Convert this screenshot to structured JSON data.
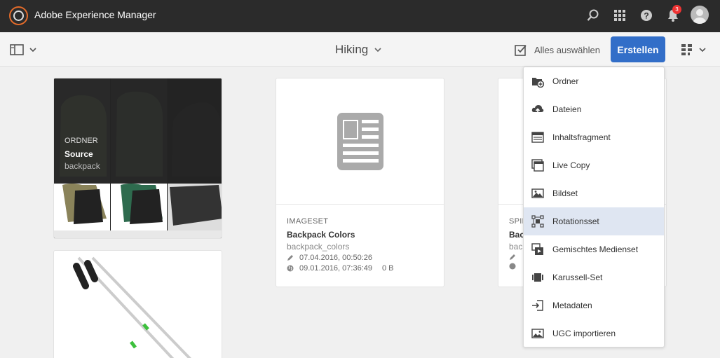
{
  "header": {
    "app_title": "Adobe Experience Manager",
    "notification_count": "3"
  },
  "actionbar": {
    "breadcrumb": "Hiking",
    "select_all_label": "Alles auswählen",
    "create_label": "Erstellen"
  },
  "cards": [
    {
      "type": "ORDNER",
      "title": "Source",
      "name": "backpack"
    },
    {
      "type": "IMAGESET",
      "title": "Backpack Colors",
      "name": "backpack_colors",
      "modified": "07.04.2016, 00:50:26",
      "published": "09.01.2016, 07:36:49",
      "size": "0 B"
    },
    {
      "type": "SPIN",
      "title": "Bac",
      "name": "back"
    }
  ],
  "create_menu": {
    "items": [
      {
        "label": "Ordner",
        "icon": "folder-add-icon"
      },
      {
        "label": "Dateien",
        "icon": "upload-cloud-icon"
      },
      {
        "label": "Inhaltsfragment",
        "icon": "content-fragment-icon"
      },
      {
        "label": "Live Copy",
        "icon": "live-copy-icon"
      },
      {
        "label": "Bildset",
        "icon": "image-set-icon"
      },
      {
        "label": "Rotationsset",
        "icon": "spin-set-icon"
      },
      {
        "label": "Gemischtes Medienset",
        "icon": "mixed-media-set-icon"
      },
      {
        "label": "Karussell-Set",
        "icon": "carousel-set-icon"
      },
      {
        "label": "Metadaten",
        "icon": "metadata-import-icon"
      },
      {
        "label": "UGC importieren",
        "icon": "ugc-import-icon"
      }
    ],
    "highlighted": "Rotationsset"
  },
  "colors": {
    "topbar_bg": "#2b2b2b",
    "accent": "#326ec8",
    "highlight": "#dfe6f2",
    "badge": "#e33333"
  }
}
